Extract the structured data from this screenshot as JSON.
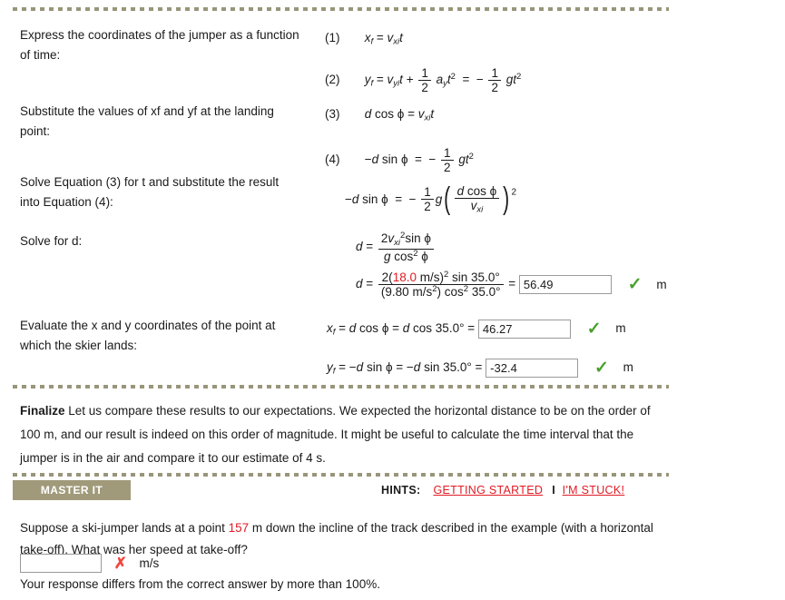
{
  "rules": {
    "style": "dotted-khaki",
    "color": "#99957a"
  },
  "steps": [
    {
      "label": "Express the coordinates of the jumper as a function of time:",
      "equations": [
        {
          "number": "(1)",
          "text": "xf = vxi t"
        },
        {
          "number": "(2)",
          "text": "yf = vyi t + 1/2 ay t^2 = - 1/2 g t^2"
        }
      ]
    },
    {
      "label": "Substitute the values of xf and yf at the landing point:",
      "equations": [
        {
          "number": "(3)",
          "text": "d cos phi = vxi t"
        },
        {
          "number": "(4)",
          "text": "-d sin phi = - 1/2 g t^2"
        }
      ]
    },
    {
      "label": "Solve Equation (3) for t and substitute the result into Equation (4):",
      "equations": [
        {
          "number": "",
          "text": "-d sin phi = - (1/2) g ( d cos phi / vxi )^2"
        }
      ]
    },
    {
      "label": "Solve for d:",
      "equations": [
        {
          "number": "",
          "text": "d = 2 vxi^2 sin phi / ( g cos^2 phi )"
        },
        {
          "number": "",
          "text": "d = 2(18.0 m/s)^2 sin 35.0 / ((9.80 m/s^2) cos^2 35.0)"
        }
      ]
    },
    {
      "label": "Evaluate the x and y coordinates of the point at which the skier lands:",
      "equations": [
        {
          "number": "",
          "text": "xf = d cos phi = d cos 35.0"
        },
        {
          "number": "",
          "text": "yf = -d sin phi = -d sin 35.0"
        }
      ]
    }
  ],
  "math": {
    "eq1_num": "(1)",
    "eq2_num": "(2)",
    "eq3_num": "(3)",
    "eq4_num": "(4)",
    "speed_value": "18.0",
    "speed_unit": "m/s",
    "gravity_value": "9.80",
    "gravity_unit": "m/s",
    "angle": "35.0°",
    "two": "2",
    "one": "1"
  },
  "answers": {
    "distance": {
      "value": "56.49",
      "unit": "m",
      "status": "correct",
      "mark": "✓"
    },
    "x_coord": {
      "value": "46.27",
      "unit": "m",
      "status": "correct",
      "mark": "✓"
    },
    "y_coord": {
      "value": "-32.4",
      "unit": "m",
      "status": "correct",
      "mark": "✓"
    }
  },
  "finalize": {
    "heading": "Finalize",
    "body": " Let us compare these results to our expectations. We expected the horizontal distance to be on the order of 100 m, and our result is indeed on this order of magnitude. It might be useful to calculate the time interval that the jumper is in the air and compare it to our estimate of 4 s."
  },
  "master_it": {
    "bar_label": "MASTER IT",
    "hints_label": "HINTS:",
    "link_getting_started": "GETTING STARTED",
    "separator": "I",
    "link_im_stuck": "I'M STUCK!",
    "question_part1": "Suppose a ski-jumper lands at a point ",
    "question_highlight": "157",
    "question_part2": " m down the incline of the track described in the example (with a horizontal take-off). What was her speed at take-off?",
    "input_value": "",
    "input_placeholder": "",
    "mark": "✗",
    "unit": "m/s",
    "feedback": "Your response differs from the correct answer by more than 100%."
  },
  "colors": {
    "accent_red": "#e01b24",
    "correct_green": "#4aa02c",
    "incorrect_red": "#f2453d",
    "khaki": "#a09a7a"
  }
}
